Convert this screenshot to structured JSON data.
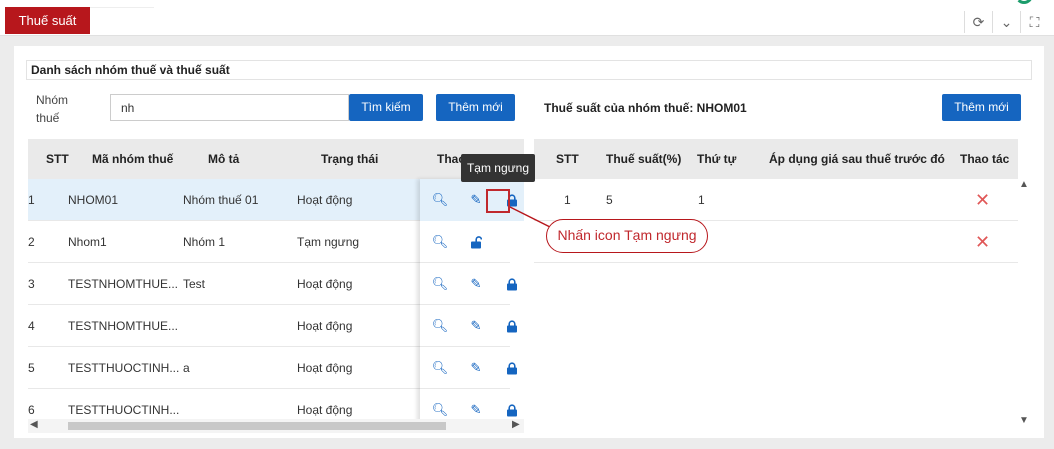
{
  "header": {
    "active_tab": "Thuế suất",
    "controls": [
      "refresh-icon",
      "chevron-down-icon",
      "fullscreen-icon"
    ]
  },
  "section": {
    "title": "Danh sách nhóm thuế và thuế suất"
  },
  "search": {
    "label": "Nhóm thuế",
    "value": "nh",
    "search_button": "Tìm kiếm",
    "add_button": "Thêm mới"
  },
  "left_table": {
    "headers": [
      "STT",
      "Mã nhóm thuế",
      "Mô tả",
      "Trạng thái",
      "Thao tác"
    ],
    "rows": [
      {
        "stt": "1",
        "code": "NHOM01",
        "desc": "Nhóm thuế 01",
        "status": "Hoạt động",
        "lock": "locked"
      },
      {
        "stt": "2",
        "code": "Nhom1",
        "desc": "Nhóm 1",
        "status": "Tạm ngưng",
        "lock": "unlocked"
      },
      {
        "stt": "3",
        "code": "TESTNHOMTHUE...",
        "desc": "Test",
        "status": "Hoạt động",
        "lock": "locked"
      },
      {
        "stt": "4",
        "code": "TESTNHOMTHUE...",
        "desc": "",
        "status": "Hoạt động",
        "lock": "locked"
      },
      {
        "stt": "5",
        "code": "TESTTHUOCTINH...",
        "desc": "a",
        "status": "Hoạt động",
        "lock": "locked"
      },
      {
        "stt": "6",
        "code": "TESTTHUOCTINH...",
        "desc": "",
        "status": "Hoạt động",
        "lock": "locked"
      }
    ]
  },
  "right_panel": {
    "title": "Thuế suất của nhóm thuế: NHOM01",
    "add_button": "Thêm mới",
    "headers": [
      "STT",
      "Thuế suất(%)",
      "Thứ tự",
      "Áp dụng giá sau thuế trước đó",
      "Thao tác"
    ],
    "rows": [
      {
        "stt": "1",
        "rate": "5",
        "order": "1",
        "apply": ""
      },
      {
        "stt": "",
        "rate": "",
        "order": "",
        "apply": ""
      }
    ]
  },
  "annotation": {
    "tooltip": "Tạm ngưng",
    "callout": "Nhấn icon Tạm ngưng"
  },
  "colors": {
    "brand_red": "#b7171c",
    "primary_blue": "#1565c0",
    "delete_red": "#e05757"
  }
}
